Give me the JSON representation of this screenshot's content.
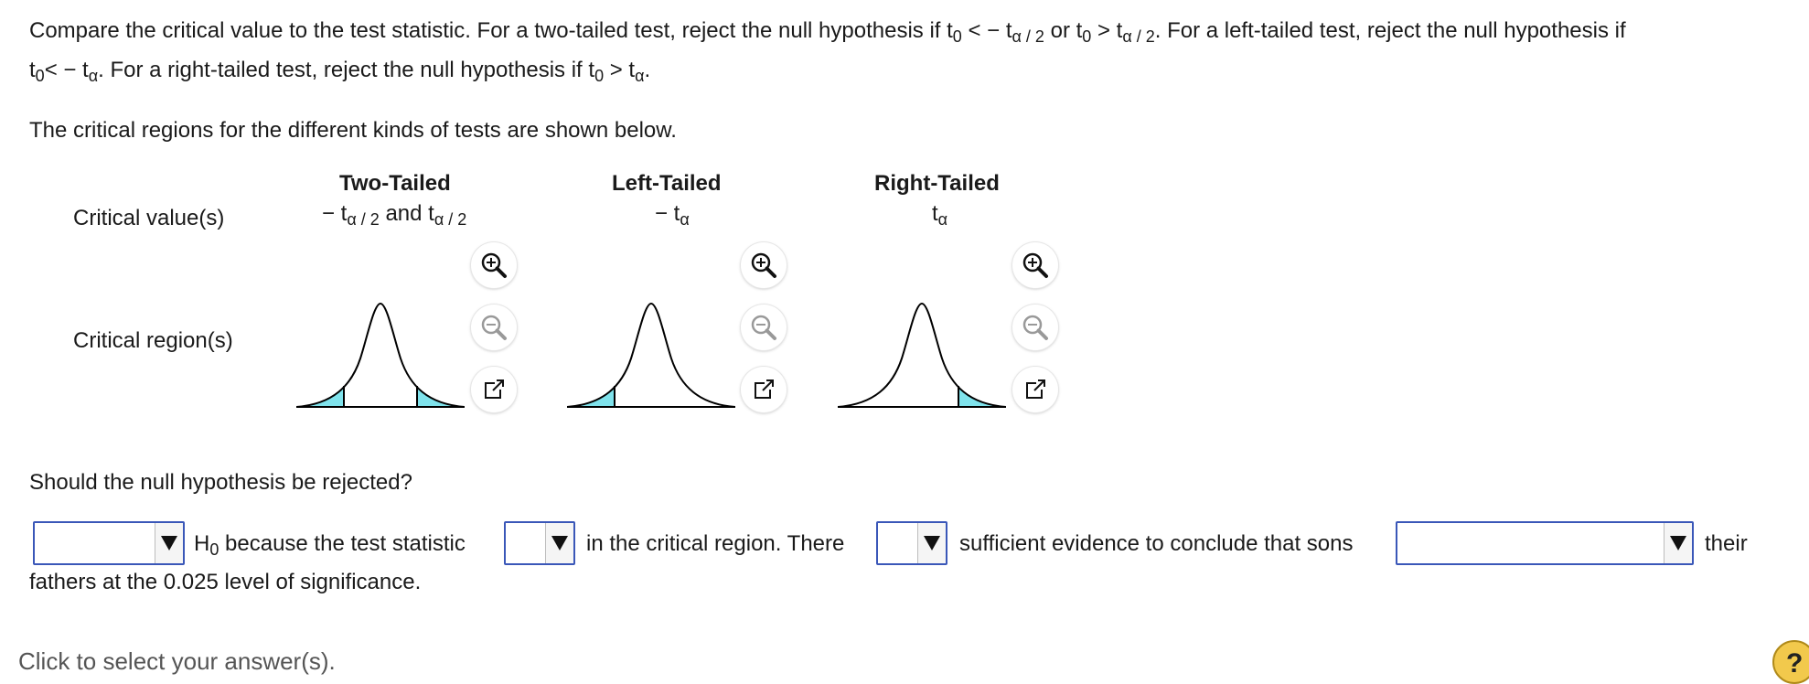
{
  "intro": {
    "p1": "Compare the critical value to the test statistic. For a two-tailed test, reject the null hypothesis if t",
    "sub_0": "0",
    "lt": " < − t",
    "sub_a2": "α / 2",
    "or_t": "  or t",
    "gt": " > t",
    "p1_end": ". For a left-tailed test, reject the null hypothesis if",
    "l2_t": "t",
    "l2_lt": "< − t",
    "sub_a": "α",
    "l2_mid": ". For a right-tailed test, reject the null hypothesis if t",
    "l2_gt": " > t",
    "l2_end": "."
  },
  "regions_intro": "The critical regions for the different kinds of tests are shown below.",
  "table": {
    "row_critical_values": "Critical value(s)",
    "row_critical_regions": "Critical region(s)",
    "two_tailed": {
      "header": "Two-Tailed",
      "cv_minus": "− t",
      "cv_sub1": "α / 2",
      "cv_and": " and t",
      "cv_sub2": "α / 2"
    },
    "left_tailed": {
      "header": "Left-Tailed",
      "cv_minus": "− t",
      "cv_sub": "α"
    },
    "right_tailed": {
      "header": "Right-Tailed",
      "cv_t": "t",
      "cv_sub": "α"
    }
  },
  "question": "Should the null hypothesis be rejected?",
  "answer": {
    "h": "H",
    "h_sub": "0",
    "s1": " because the test statistic",
    "s2": "in the critical region. There",
    "s3": "sufficient evidence to conclude that sons",
    "s4": "their",
    "line2": "fathers at the 0.025 level of significance.",
    "dropdown1_value": "",
    "dropdown2_value": "",
    "dropdown3_value": "",
    "dropdown4_value": ""
  },
  "footer": {
    "hint": "Click to select your answer(s).",
    "help": "?"
  },
  "icons": {
    "zoom_in": "zoom-in-icon",
    "zoom_out": "zoom-out-icon",
    "popout": "popout-icon",
    "dropdown_arrow": "triangle-down-icon",
    "help": "question-mark-icon"
  },
  "colors": {
    "tail_shade": "#7fe3ec",
    "dropdown_border": "#3a57b8",
    "help_bg": "#f2c94c"
  }
}
